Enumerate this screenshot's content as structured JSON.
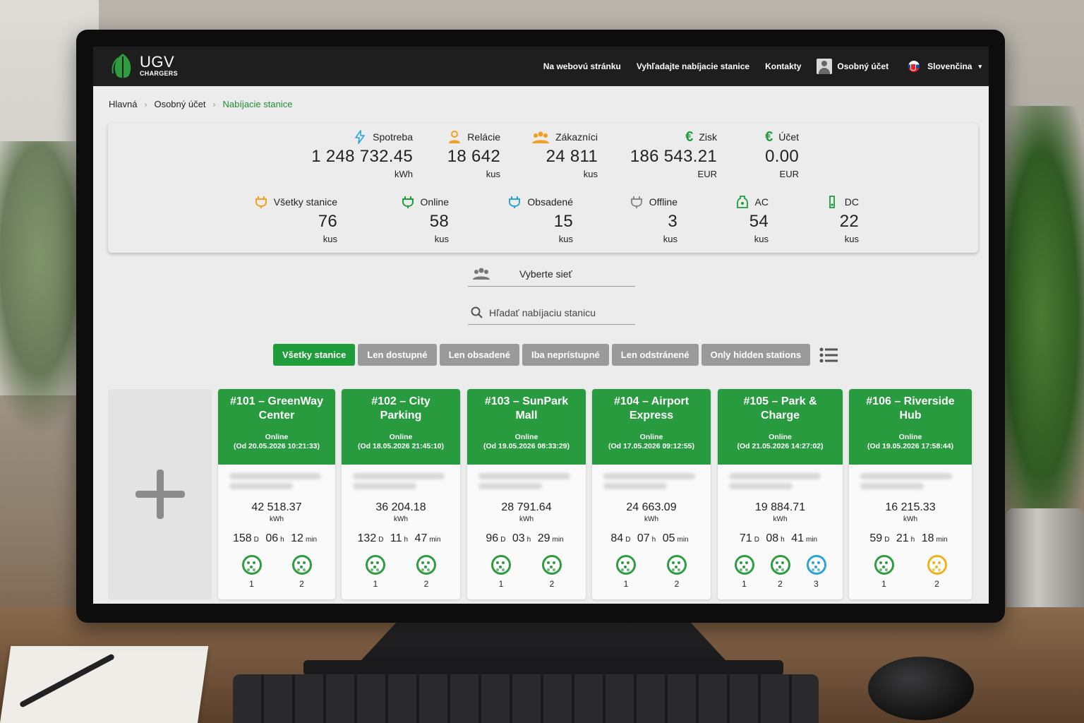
{
  "nav": {
    "logo_main": "UGV",
    "logo_sub": "CHARGERS",
    "links": [
      "Na webovú stránku",
      "Vyhľadajte nabíjacie stanice",
      "Kontakty"
    ],
    "account": "Osobný účet",
    "language": "Slovenčina"
  },
  "breadcrumb": [
    "Hlavná",
    "Osobný účet",
    "Nabíjacie stanice"
  ],
  "stats_top": [
    {
      "label": "Spotreba",
      "value": "1 248 732.45",
      "unit": "kWh",
      "icon": "lightning-icon",
      "color": "#2aa3dc"
    },
    {
      "label": "Relácie",
      "value": "18 642",
      "unit": "kus",
      "icon": "user-icon",
      "color": "#f0a01c"
    },
    {
      "label": "Zákazníci",
      "value": "24 811",
      "unit": "kus",
      "icon": "users-icon",
      "color": "#f0a01c"
    },
    {
      "label": "Zisk",
      "value": "186 543.21",
      "unit": "EUR",
      "icon": "euro-icon",
      "color": "#1f9d3a"
    },
    {
      "label": "Účet",
      "value": "0.00",
      "unit": "EUR",
      "icon": "euro-icon",
      "color": "#1f9d3a"
    }
  ],
  "stats_bottom": [
    {
      "label": "Všetky stanice",
      "value": "76",
      "unit": "kus",
      "icon": "plug-icon",
      "color": "#f0a01c"
    },
    {
      "label": "Online",
      "value": "58",
      "unit": "kus",
      "icon": "plug-icon",
      "color": "#1f9d3a"
    },
    {
      "label": "Obsadené",
      "value": "15",
      "unit": "kus",
      "icon": "plug-icon",
      "color": "#2aa3dc"
    },
    {
      "label": "Offline",
      "value": "3",
      "unit": "kus",
      "icon": "plug-icon",
      "color": "#8a8a8a"
    },
    {
      "label": "AC",
      "value": "54",
      "unit": "kus",
      "icon": "ac-connector-icon",
      "color": "#1f9d3a"
    },
    {
      "label": "DC",
      "value": "22",
      "unit": "kus",
      "icon": "dc-connector-icon",
      "color": "#1f9d3a"
    }
  ],
  "network_select": "Vyberte sieť",
  "search_placeholder": "Hľadať nabíjaciu stanicu",
  "tabs": [
    "Všetky stanice",
    "Len dostupné",
    "Len obsadené",
    "Iba neprístupné",
    "Len odstránené",
    "Only hidden stations"
  ],
  "active_tab": "Všetky stanice",
  "stations": [
    {
      "title": "#101 – GreenWay Center",
      "status": "Online",
      "since": "(Od 20.05.2026 10:21:33)",
      "kwh": "42 518.37",
      "kwh_unit": "kWh",
      "d": "158",
      "h": "06",
      "m": "12",
      "connectors": [
        {
          "n": "1",
          "color": "green"
        },
        {
          "n": "2",
          "color": "green"
        }
      ]
    },
    {
      "title": "#102 – City Parking",
      "status": "Online",
      "since": "(Od 18.05.2026 21:45:10)",
      "kwh": "36 204.18",
      "kwh_unit": "kWh",
      "d": "132",
      "h": "11",
      "m": "47",
      "connectors": [
        {
          "n": "1",
          "color": "green"
        },
        {
          "n": "2",
          "color": "green"
        }
      ]
    },
    {
      "title": "#103 – SunPark Mall",
      "status": "Online",
      "since": "(Od 19.05.2026 08:33:29)",
      "kwh": "28 791.64",
      "kwh_unit": "kWh",
      "d": "96",
      "h": "03",
      "m": "29",
      "connectors": [
        {
          "n": "1",
          "color": "green"
        },
        {
          "n": "2",
          "color": "green"
        }
      ]
    },
    {
      "title": "#104 – Airport Express",
      "status": "Online",
      "since": "(Od 17.05.2026 09:12:55)",
      "kwh": "24 663.09",
      "kwh_unit": "kWh",
      "d": "84",
      "h": "07",
      "m": "05",
      "connectors": [
        {
          "n": "1",
          "color": "green"
        },
        {
          "n": "2",
          "color": "green"
        }
      ]
    },
    {
      "title": "#105 – Park & Charge",
      "status": "Online",
      "since": "(Od 21.05.2026 14:27:02)",
      "kwh": "19 884.71",
      "kwh_unit": "kWh",
      "d": "71",
      "h": "08",
      "m": "41",
      "connectors": [
        {
          "n": "1",
          "color": "green"
        },
        {
          "n": "2",
          "color": "green"
        },
        {
          "n": "3",
          "color": "blue"
        }
      ]
    },
    {
      "title": "#106 – Riverside Hub",
      "status": "Online",
      "since": "(Od 19.05.2026 17:58:44)",
      "kwh": "16 215.33",
      "kwh_unit": "kWh",
      "d": "59",
      "h": "21",
      "m": "18",
      "connectors": [
        {
          "n": "1",
          "color": "green"
        },
        {
          "n": "2",
          "color": "orange"
        }
      ]
    }
  ],
  "time_units": {
    "d": "D",
    "h": "h",
    "m": "min"
  }
}
